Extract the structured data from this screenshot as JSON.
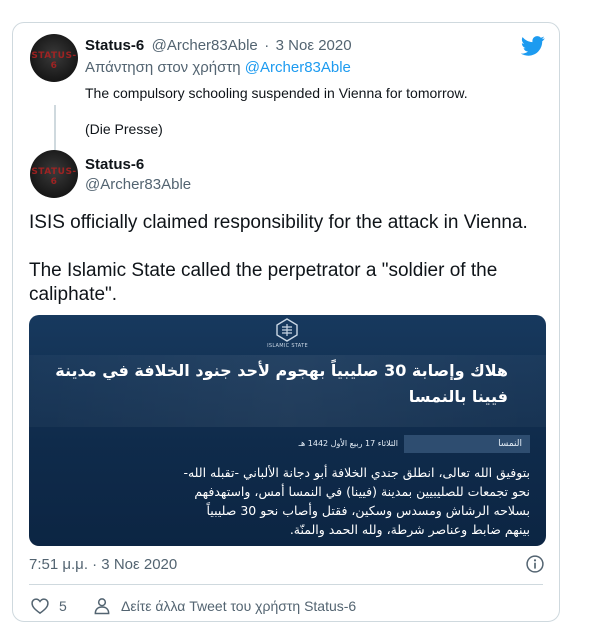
{
  "reply_tweet": {
    "display_name": "Status-6",
    "handle": "@Archer83Able",
    "separator": "·",
    "date": "3 Νοε 2020",
    "reply_prefix": "Απάντηση στον χρήστη",
    "reply_handle": "@Archer83Able",
    "text_line1": "The compulsory schooling suspended in Vienna for tomorrow.",
    "text_line2": "(Die Presse)"
  },
  "avatar": {
    "logo_text": "STATUS-6"
  },
  "main_tweet": {
    "display_name": "Status-6",
    "handle": "@Archer83Able",
    "text_para1": "ISIS officially claimed responsibility for the attack in Vienna.",
    "text_para2_line1": "The Islamic State called the perpetrator a \"soldier of the",
    "text_para2_line2": "caliphate\"."
  },
  "image": {
    "logo_caption": "ISLAMIC STATE",
    "headline_line1": "هلاك وإصابة 30 صليبياً بهجوم لأحد جنود الخلافة في مدينة",
    "headline_line2": "فيينا بالنمسا",
    "tag_country": "النمسا",
    "tag_date": "الثلاثاء 17 ربيع الأول 1442 هـ",
    "body_line1": "بتوفيق الله تعالى، انطلق جندي الخلافة أبو دجانة الألباني -تقبله الله-",
    "body_line2": "نحو تجمعات للصليبيين بمدينة (فيينا) في النمسا أمس، واستهدفهم",
    "body_line3": "بسلاحه الرشاش ومسدس وسكين، فقتل وأصاب نحو 30 صليبياً",
    "body_line4": "بينهم ضابط وعناصر شرطة، ولله الحمد والمنّة."
  },
  "meta": {
    "timestamp": "7:51 μ.μ. · 3 Νοε 2020"
  },
  "actions": {
    "like_count": "5",
    "profile_link": "Δείτε άλλα Tweet του χρήστη Status-6"
  },
  "icons": {
    "bird": "twitter-bird-icon",
    "info": "info-icon",
    "heart": "heart-icon",
    "person": "person-icon"
  },
  "colors": {
    "accent": "#1d9bf0",
    "muted": "#536471",
    "border": "#cfd9de",
    "image_bg": "#0f2b4b",
    "image_tag": "#2e4d70"
  }
}
